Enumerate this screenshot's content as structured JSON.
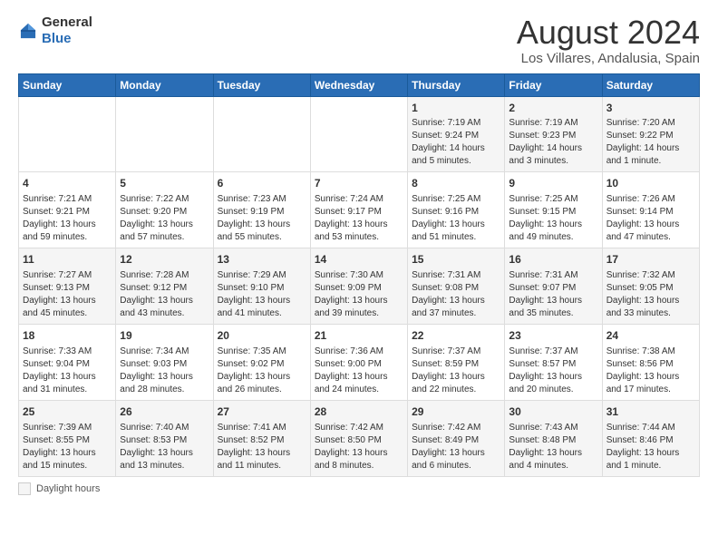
{
  "header": {
    "logo_general": "General",
    "logo_blue": "Blue",
    "title": "August 2024",
    "subtitle": "Los Villares, Andalusia, Spain"
  },
  "calendar": {
    "days_of_week": [
      "Sunday",
      "Monday",
      "Tuesday",
      "Wednesday",
      "Thursday",
      "Friday",
      "Saturday"
    ],
    "weeks": [
      [
        {
          "day": "",
          "info": ""
        },
        {
          "day": "",
          "info": ""
        },
        {
          "day": "",
          "info": ""
        },
        {
          "day": "",
          "info": ""
        },
        {
          "day": "1",
          "info": "Sunrise: 7:19 AM\nSunset: 9:24 PM\nDaylight: 14 hours and 5 minutes."
        },
        {
          "day": "2",
          "info": "Sunrise: 7:19 AM\nSunset: 9:23 PM\nDaylight: 14 hours and 3 minutes."
        },
        {
          "day": "3",
          "info": "Sunrise: 7:20 AM\nSunset: 9:22 PM\nDaylight: 14 hours and 1 minute."
        }
      ],
      [
        {
          "day": "4",
          "info": "Sunrise: 7:21 AM\nSunset: 9:21 PM\nDaylight: 13 hours and 59 minutes."
        },
        {
          "day": "5",
          "info": "Sunrise: 7:22 AM\nSunset: 9:20 PM\nDaylight: 13 hours and 57 minutes."
        },
        {
          "day": "6",
          "info": "Sunrise: 7:23 AM\nSunset: 9:19 PM\nDaylight: 13 hours and 55 minutes."
        },
        {
          "day": "7",
          "info": "Sunrise: 7:24 AM\nSunset: 9:17 PM\nDaylight: 13 hours and 53 minutes."
        },
        {
          "day": "8",
          "info": "Sunrise: 7:25 AM\nSunset: 9:16 PM\nDaylight: 13 hours and 51 minutes."
        },
        {
          "day": "9",
          "info": "Sunrise: 7:25 AM\nSunset: 9:15 PM\nDaylight: 13 hours and 49 minutes."
        },
        {
          "day": "10",
          "info": "Sunrise: 7:26 AM\nSunset: 9:14 PM\nDaylight: 13 hours and 47 minutes."
        }
      ],
      [
        {
          "day": "11",
          "info": "Sunrise: 7:27 AM\nSunset: 9:13 PM\nDaylight: 13 hours and 45 minutes."
        },
        {
          "day": "12",
          "info": "Sunrise: 7:28 AM\nSunset: 9:12 PM\nDaylight: 13 hours and 43 minutes."
        },
        {
          "day": "13",
          "info": "Sunrise: 7:29 AM\nSunset: 9:10 PM\nDaylight: 13 hours and 41 minutes."
        },
        {
          "day": "14",
          "info": "Sunrise: 7:30 AM\nSunset: 9:09 PM\nDaylight: 13 hours and 39 minutes."
        },
        {
          "day": "15",
          "info": "Sunrise: 7:31 AM\nSunset: 9:08 PM\nDaylight: 13 hours and 37 minutes."
        },
        {
          "day": "16",
          "info": "Sunrise: 7:31 AM\nSunset: 9:07 PM\nDaylight: 13 hours and 35 minutes."
        },
        {
          "day": "17",
          "info": "Sunrise: 7:32 AM\nSunset: 9:05 PM\nDaylight: 13 hours and 33 minutes."
        }
      ],
      [
        {
          "day": "18",
          "info": "Sunrise: 7:33 AM\nSunset: 9:04 PM\nDaylight: 13 hours and 31 minutes."
        },
        {
          "day": "19",
          "info": "Sunrise: 7:34 AM\nSunset: 9:03 PM\nDaylight: 13 hours and 28 minutes."
        },
        {
          "day": "20",
          "info": "Sunrise: 7:35 AM\nSunset: 9:02 PM\nDaylight: 13 hours and 26 minutes."
        },
        {
          "day": "21",
          "info": "Sunrise: 7:36 AM\nSunset: 9:00 PM\nDaylight: 13 hours and 24 minutes."
        },
        {
          "day": "22",
          "info": "Sunrise: 7:37 AM\nSunset: 8:59 PM\nDaylight: 13 hours and 22 minutes."
        },
        {
          "day": "23",
          "info": "Sunrise: 7:37 AM\nSunset: 8:57 PM\nDaylight: 13 hours and 20 minutes."
        },
        {
          "day": "24",
          "info": "Sunrise: 7:38 AM\nSunset: 8:56 PM\nDaylight: 13 hours and 17 minutes."
        }
      ],
      [
        {
          "day": "25",
          "info": "Sunrise: 7:39 AM\nSunset: 8:55 PM\nDaylight: 13 hours and 15 minutes."
        },
        {
          "day": "26",
          "info": "Sunrise: 7:40 AM\nSunset: 8:53 PM\nDaylight: 13 hours and 13 minutes."
        },
        {
          "day": "27",
          "info": "Sunrise: 7:41 AM\nSunset: 8:52 PM\nDaylight: 13 hours and 11 minutes."
        },
        {
          "day": "28",
          "info": "Sunrise: 7:42 AM\nSunset: 8:50 PM\nDaylight: 13 hours and 8 minutes."
        },
        {
          "day": "29",
          "info": "Sunrise: 7:42 AM\nSunset: 8:49 PM\nDaylight: 13 hours and 6 minutes."
        },
        {
          "day": "30",
          "info": "Sunrise: 7:43 AM\nSunset: 8:48 PM\nDaylight: 13 hours and 4 minutes."
        },
        {
          "day": "31",
          "info": "Sunrise: 7:44 AM\nSunset: 8:46 PM\nDaylight: 13 hours and 1 minute."
        }
      ]
    ]
  },
  "footer": {
    "daylight_label": "Daylight hours"
  }
}
